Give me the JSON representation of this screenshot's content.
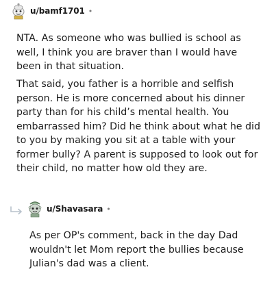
{
  "comments": [
    {
      "username": "u/bamf1701",
      "separator": "•",
      "avatar_icon": "snoo-avatar-icon",
      "paragraphs": [
        "NTA. As someone who was bullied is school as well, I think you are braver than I would have been in that situation.",
        "That said, you father is a horrible and selfish person. He is more concerned about his dinner party than for his child’s mental health. You embarrassed him? Did he think about what he did to you by making you sit at a table with your former bully? A parent is supposed to look out for their child, no matter how old they are."
      ]
    },
    {
      "username": "u/Shavasara",
      "separator": "•",
      "avatar_icon": "snoo-avatar-icon",
      "reply_icon": "reply-arrow-icon",
      "paragraphs": [
        "As per OP's comment, back in the day Dad wouldn't let Mom report the bullies because Julian's dad was a client."
      ]
    }
  ],
  "colors": {
    "text": "#1c1c1c",
    "muted": "#7c7c7c",
    "reply_line": "#b8c2cc"
  }
}
